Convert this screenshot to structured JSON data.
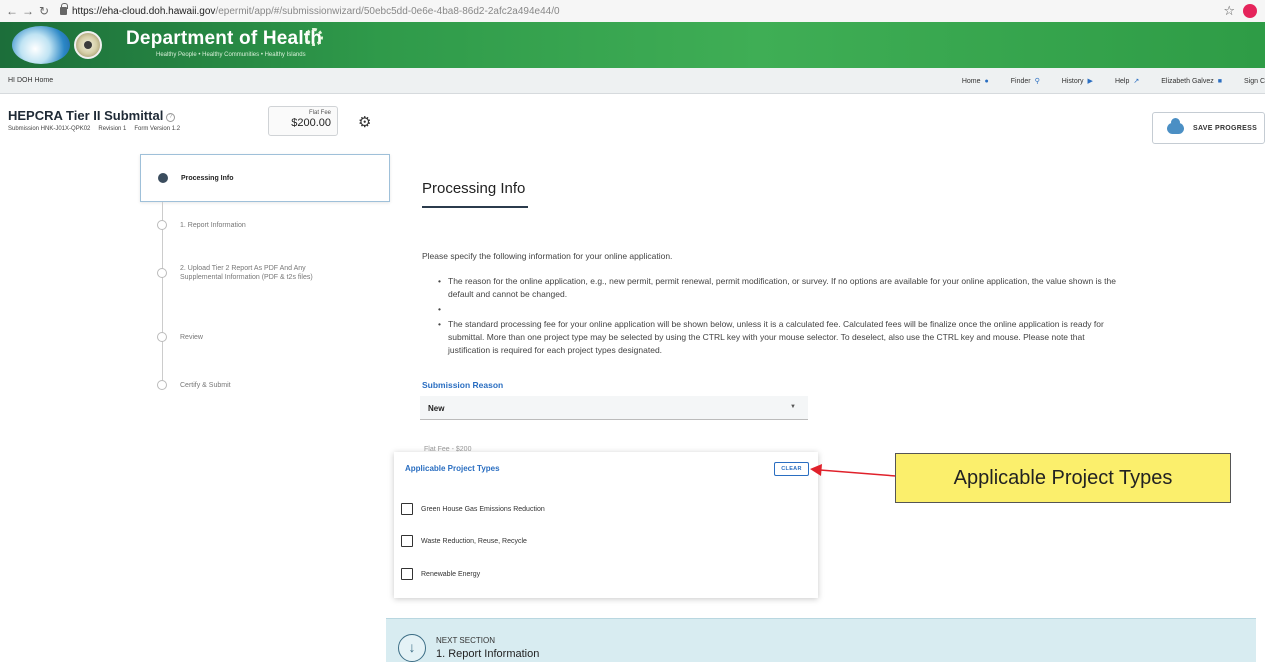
{
  "browser": {
    "url_host": "https://eha-cloud.doh.hawaii.gov",
    "url_path": "/epermit/app/#/submissionwizard/50ebc5dd-0e6e-4ba8-86d2-2afc2a494e44/0"
  },
  "header": {
    "title": "Department of Health",
    "tagline": "Healthy People • Healthy Communities • Healthy Islands"
  },
  "subnav": {
    "home": "HI DOH Home",
    "items": [
      {
        "label": "Home",
        "icon": "home-icon"
      },
      {
        "label": "Finder",
        "icon": "search-icon"
      },
      {
        "label": "History",
        "icon": "history-icon"
      },
      {
        "label": "Help",
        "icon": "external-link-icon"
      },
      {
        "label": "Elizabeth Galvez",
        "icon": "user-icon"
      },
      {
        "label": "Sign C",
        "icon": ""
      }
    ]
  },
  "submission": {
    "title": "HEPCRA Tier II Submittal",
    "id": "Submission HNK-J01X-QPK02",
    "revision": "Revision 1",
    "form_version": "Form Version 1.2",
    "fee_label": "Flat Fee",
    "fee_value": "$200.00",
    "save_label": "SAVE PROGRESS"
  },
  "steps": [
    {
      "label": "Processing Info",
      "active": true
    },
    {
      "label": "1. Report Information",
      "active": false
    },
    {
      "label": "2. Upload Tier 2 Report As PDF And Any Supplemental Information (PDF & t2s files)",
      "active": false
    },
    {
      "label": "Review",
      "active": false
    },
    {
      "label": "Certify & Submit",
      "active": false
    }
  ],
  "main": {
    "title": "Processing Info",
    "intro": "Please specify the following information for your online application.",
    "bullets": [
      "The reason for the online application, e.g., new permit, permit renewal, permit modification, or survey. If no options are available for your online application, the value shown is the default and cannot be changed.",
      "",
      "The standard processing fee for your online application will be shown below, unless it is a calculated fee. Calculated fees will be finalize once the online application is ready for submittal. More than one project type may be selected by using the CTRL key with your mouse selector. To deselect, also use the CTRL key and mouse. Please note that justification is required for each project types designated."
    ],
    "reason_label": "Submission Reason",
    "reason_value": "New",
    "fee_note": "Flat Fee - $200"
  },
  "project_types": {
    "title": "Applicable Project Types",
    "clear_label": "CLEAR",
    "options": [
      "Green House Gas Emissions Reduction",
      "Waste Reduction, Reuse, Recycle",
      "Renewable Energy"
    ]
  },
  "annotation": {
    "text": "Applicable Project Types",
    "arrow_color": "#e0212b"
  },
  "next_section": {
    "label": "NEXT SECTION",
    "title": "1. Report Information"
  }
}
